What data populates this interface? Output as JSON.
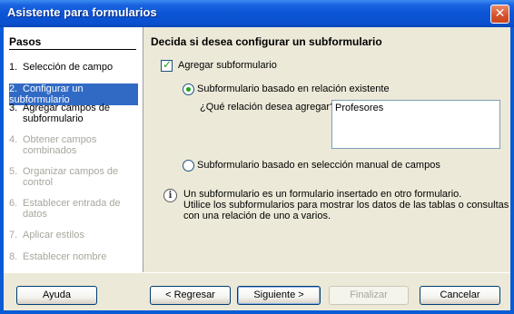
{
  "window": {
    "title": "Asistente para formularios",
    "close_glyph": "✕"
  },
  "sidebar": {
    "title": "Pasos",
    "steps": [
      {
        "num": "1.",
        "line1": "Selección de campo",
        "line2": "",
        "state": "normal"
      },
      {
        "num": "2.",
        "line1": "Configurar un subformulario",
        "line2": "",
        "state": "active"
      },
      {
        "num": "3.",
        "line1": "Agregar campos de",
        "line2": "subformulario",
        "state": "normal"
      },
      {
        "num": "4.",
        "line1": "Obtener campos",
        "line2": "combinados",
        "state": "disabled"
      },
      {
        "num": "5.",
        "line1": "Organizar campos de",
        "line2": "control",
        "state": "disabled"
      },
      {
        "num": "6.",
        "line1": "Establecer entrada de",
        "line2": "datos",
        "state": "disabled"
      },
      {
        "num": "7.",
        "line1": "Aplicar estilos",
        "line2": "",
        "state": "disabled"
      },
      {
        "num": "8.",
        "line1": "Establecer nombre",
        "line2": "",
        "state": "disabled"
      }
    ]
  },
  "main": {
    "heading": "Decida si desea configurar un subformulario",
    "add_subform": {
      "label": "Agregar subformulario",
      "checked": true
    },
    "option_existing": {
      "label": "Subformulario basado en relación existente",
      "selected": true
    },
    "relation_question": "¿Qué relación desea agregar?",
    "relation_list": [
      "Profesores"
    ],
    "option_manual": {
      "label": "Subformulario basado en selección manual de campos",
      "selected": false
    },
    "info": {
      "icon": "info-icon",
      "lines": [
        "Un subformulario es un formulario insertado en otro formulario.",
        "Utilice los subformularios para mostrar los datos de las tablas o consultas",
        "con una relación de uno a varios."
      ]
    }
  },
  "buttons": {
    "help": "Ayuda",
    "back": "< Regresar",
    "next": "Siguiente >",
    "finish": "Finalizar",
    "cancel": "Cancelar"
  },
  "colors": {
    "titlebar": "#0a50cf",
    "selection": "#316ac5",
    "dialog_bg": "#ece9d8",
    "disabled_text": "#a7a69c"
  }
}
